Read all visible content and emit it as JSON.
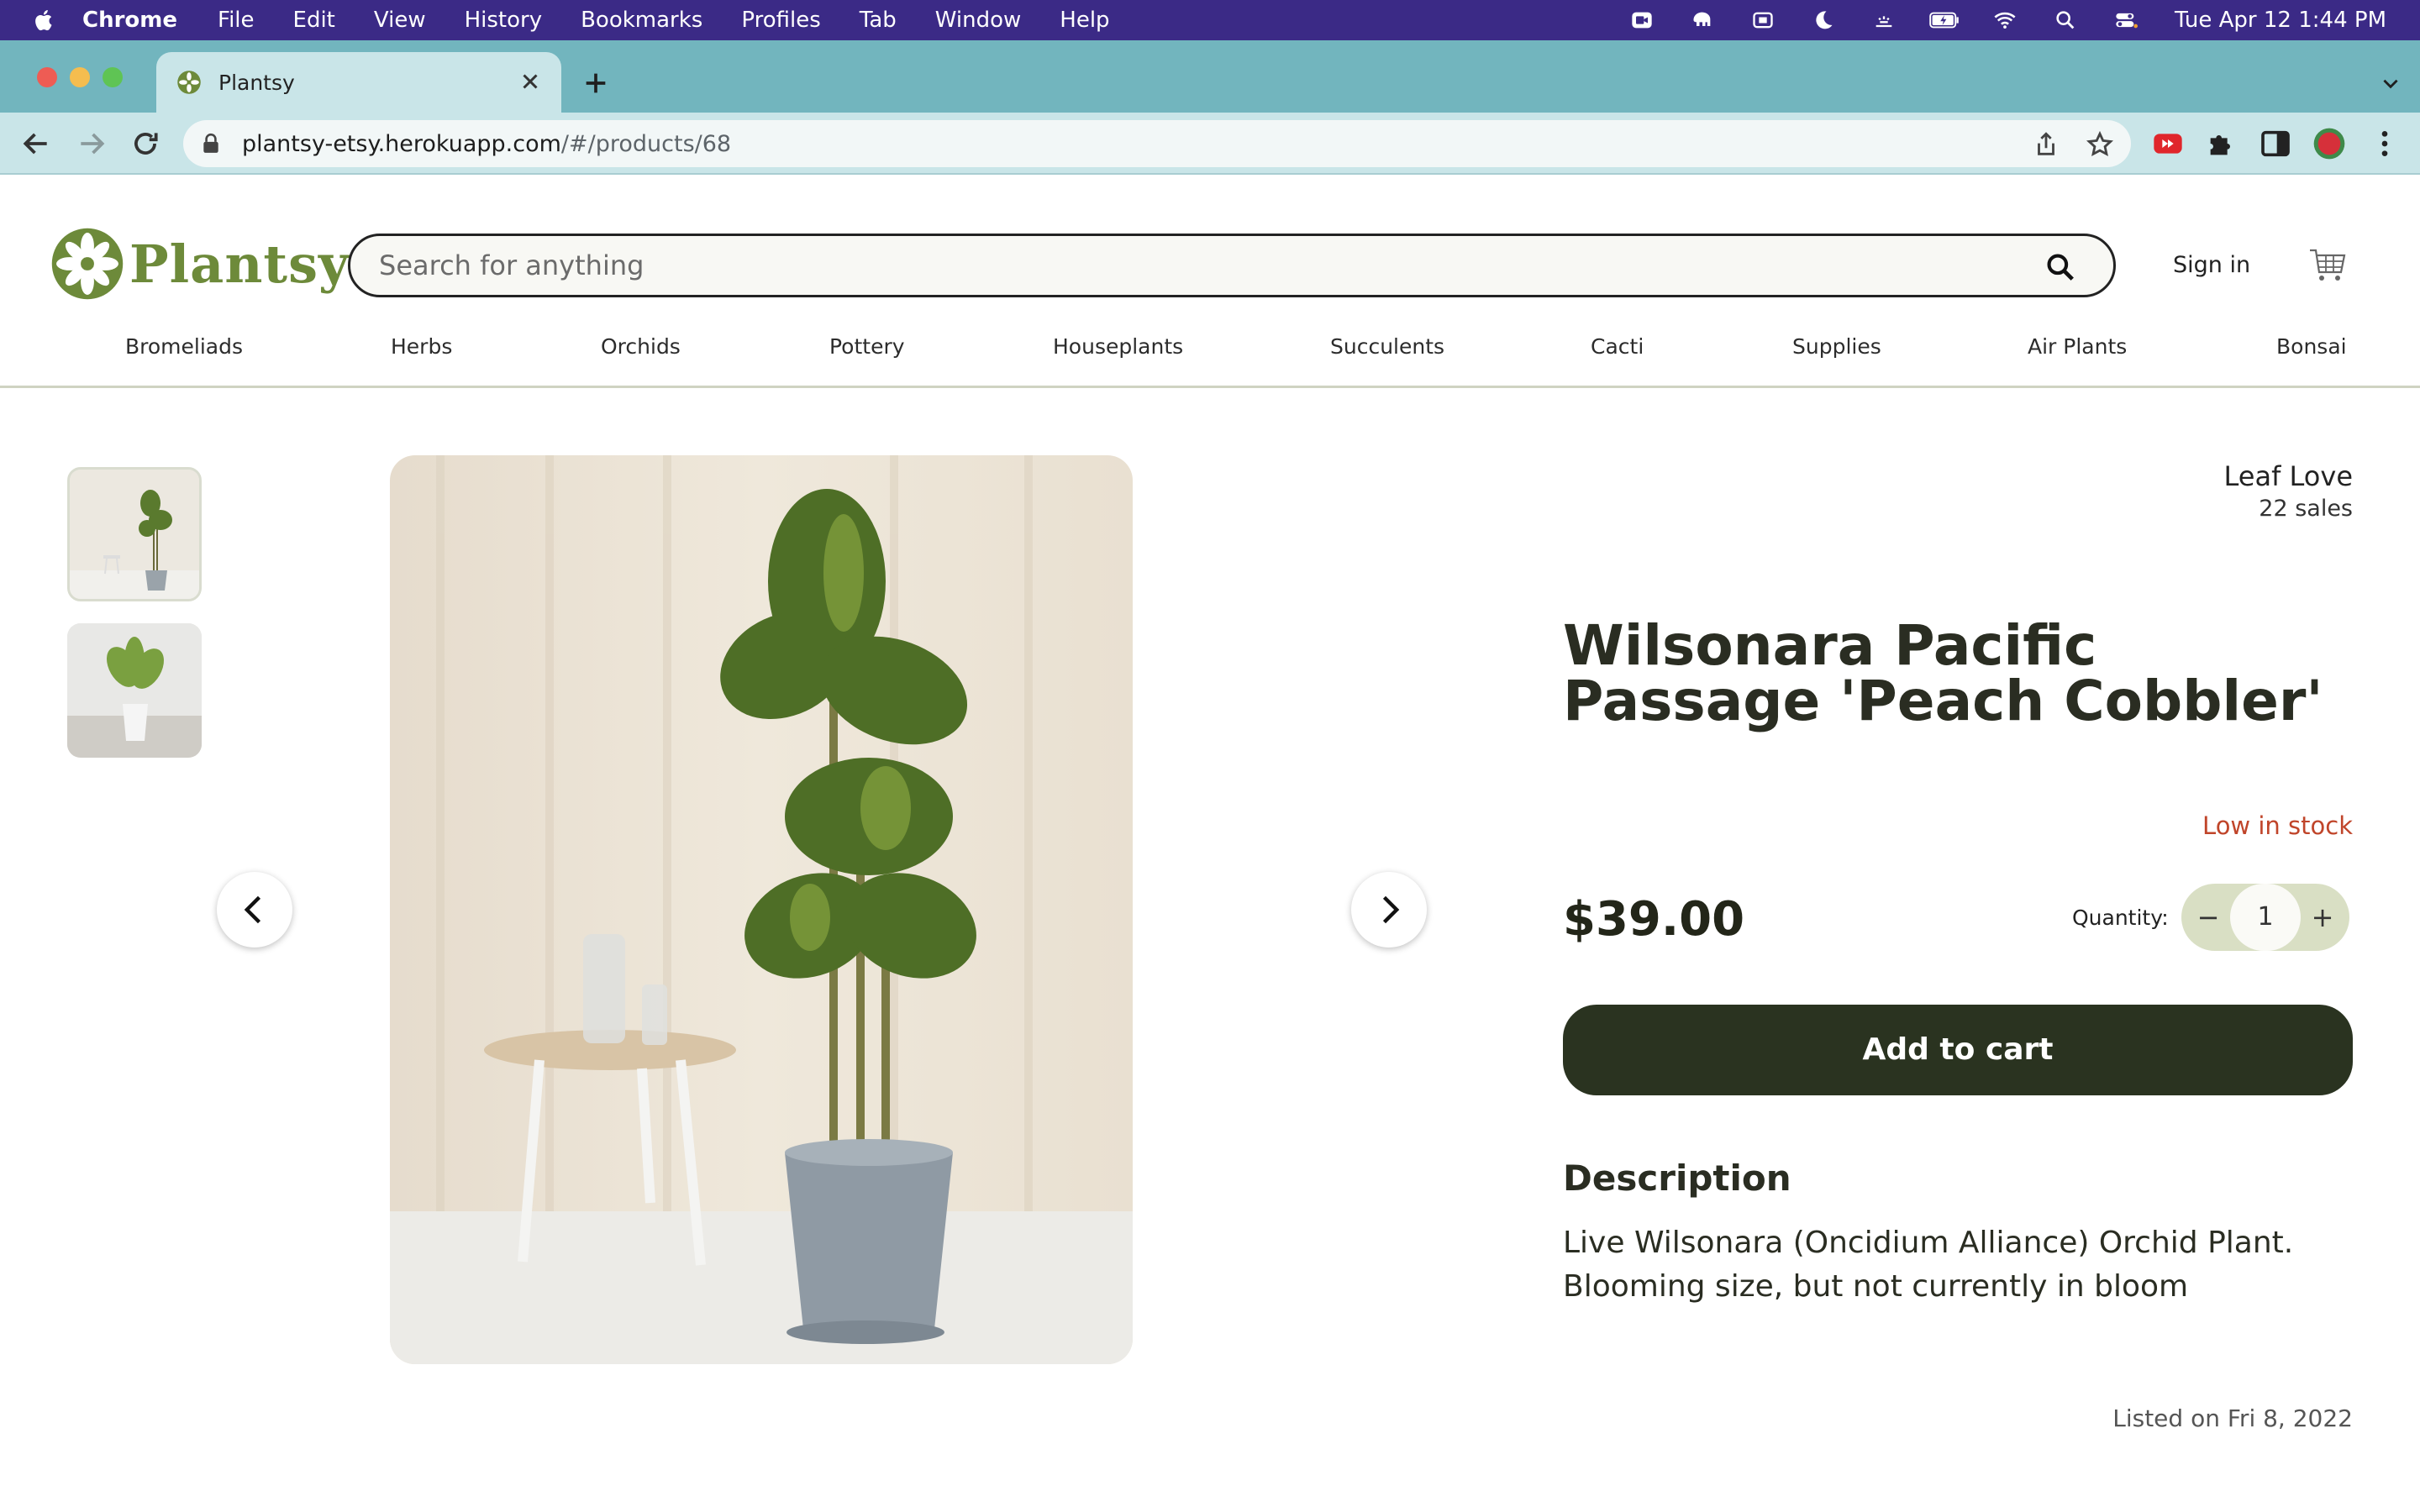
{
  "menubar": {
    "app_name": "Chrome",
    "items": [
      "File",
      "Edit",
      "View",
      "History",
      "Bookmarks",
      "Profiles",
      "Tab",
      "Window",
      "Help"
    ],
    "clock": "Tue Apr 12  1:44 PM"
  },
  "browser": {
    "tab_title": "Plantsy",
    "url_host": "plantsy-etsy.herokuapp.com",
    "url_path": "/#/products/68"
  },
  "site": {
    "logo_text": "Plantsy",
    "search_placeholder": "Search for anything",
    "signin_label": "Sign in",
    "categories": [
      "Bromeliads",
      "Herbs",
      "Orchids",
      "Pottery",
      "Houseplants",
      "Succulents",
      "Cacti",
      "Supplies",
      "Air Plants",
      "Bonsai"
    ]
  },
  "product": {
    "shop_name": "Leaf Love",
    "sales": "22 sales",
    "title": "Wilsonara Pacific Passage 'Peach Cobbler'",
    "stock_status": "Low in stock",
    "price": "$39.00",
    "quantity_label": "Quantity:",
    "quantity_value": "1",
    "quantity_minus": "−",
    "quantity_plus": "+",
    "add_to_cart_label": "Add to cart",
    "description_heading": "Description",
    "description": "Live Wilsonara (Oncidium Alliance) Orchid Plant. Blooming size, but not currently in bloom",
    "listed_on": "Listed on Fri 8, 2022"
  },
  "colors": {
    "menubar": "#3b2a86",
    "tabstrip": "#72b5be",
    "brand_green": "#6d8a3a",
    "button_dark": "#2a3320",
    "stock_warning": "#c0452a"
  }
}
